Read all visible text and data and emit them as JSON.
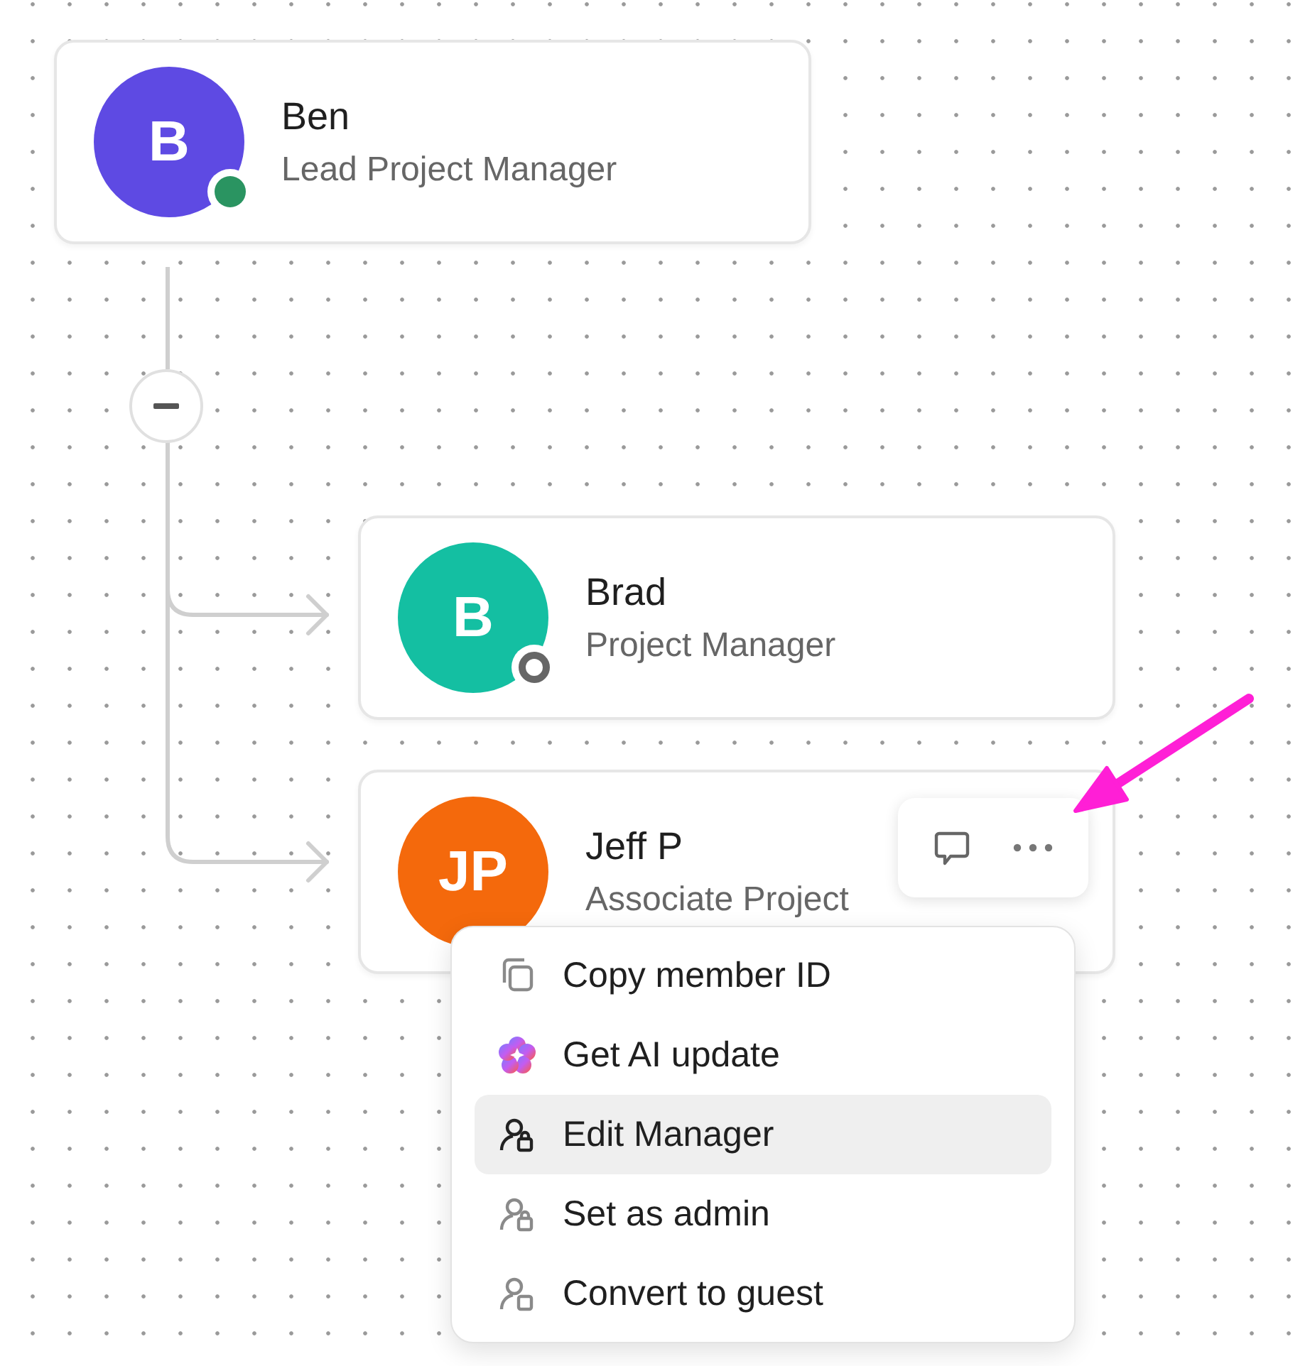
{
  "members": [
    {
      "initials": "B",
      "name": "Ben",
      "role": "Lead Project Manager",
      "color": "#5e4ae3",
      "online": true
    },
    {
      "initials": "B",
      "name": "Brad",
      "role": "Project Manager",
      "color": "#14bfa2",
      "online": false
    },
    {
      "initials": "JP",
      "name": "Jeff P",
      "role": "Associate Project",
      "color": "#f4690c"
    }
  ],
  "collapse_toggle": {
    "expanded": true
  },
  "menu": {
    "items": [
      {
        "label": "Copy member ID",
        "kind": "copy",
        "selected": false
      },
      {
        "label": "Get AI update",
        "kind": "ai",
        "selected": false
      },
      {
        "label": "Edit Manager",
        "kind": "person-lock",
        "selected": true
      },
      {
        "label": "Set as admin",
        "kind": "person-lock",
        "selected": false
      },
      {
        "label": "Convert to guest",
        "kind": "person-square",
        "selected": false
      }
    ]
  }
}
